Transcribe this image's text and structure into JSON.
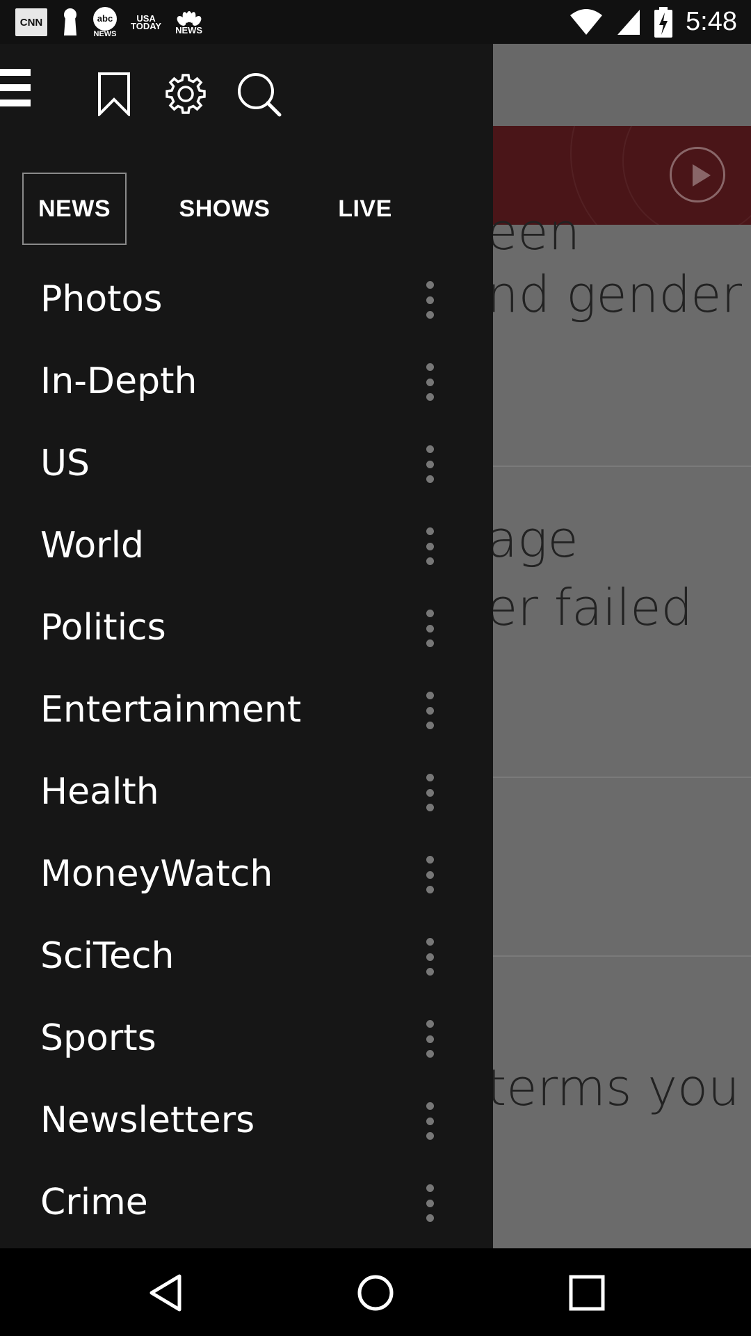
{
  "status_bar": {
    "time": "5:48",
    "notifications": [
      {
        "icon": "cnn-icon",
        "label": "CNN"
      },
      {
        "icon": "keyhole-icon",
        "label": ""
      },
      {
        "icon": "abc-news-icon",
        "label": "abc",
        "sub": "NEWS"
      },
      {
        "icon": "usa-today-icon",
        "label": "USA",
        "sub": "TODAY"
      },
      {
        "icon": "nbc-news-icon",
        "label": "NEWS"
      }
    ]
  },
  "drawer": {
    "tabs": [
      {
        "label": "NEWS",
        "active": true
      },
      {
        "label": "SHOWS",
        "active": false
      },
      {
        "label": "LIVE",
        "active": false
      }
    ],
    "items": [
      {
        "label": "Photos"
      },
      {
        "label": "In-Depth"
      },
      {
        "label": "US"
      },
      {
        "label": "World"
      },
      {
        "label": "Politics"
      },
      {
        "label": "Entertainment"
      },
      {
        "label": "Health"
      },
      {
        "label": "MoneyWatch"
      },
      {
        "label": "SciTech"
      },
      {
        "label": "Sports"
      },
      {
        "label": "Newsletters"
      },
      {
        "label": "Crime"
      }
    ]
  },
  "background_article": {
    "fragments": [
      "een",
      "nd gender",
      "age",
      "er failed",
      "terms you"
    ]
  },
  "colors": {
    "drawer_bg": "#161616",
    "banner_red": "#4a1518",
    "overlay_gray": "#6b6b6b"
  }
}
